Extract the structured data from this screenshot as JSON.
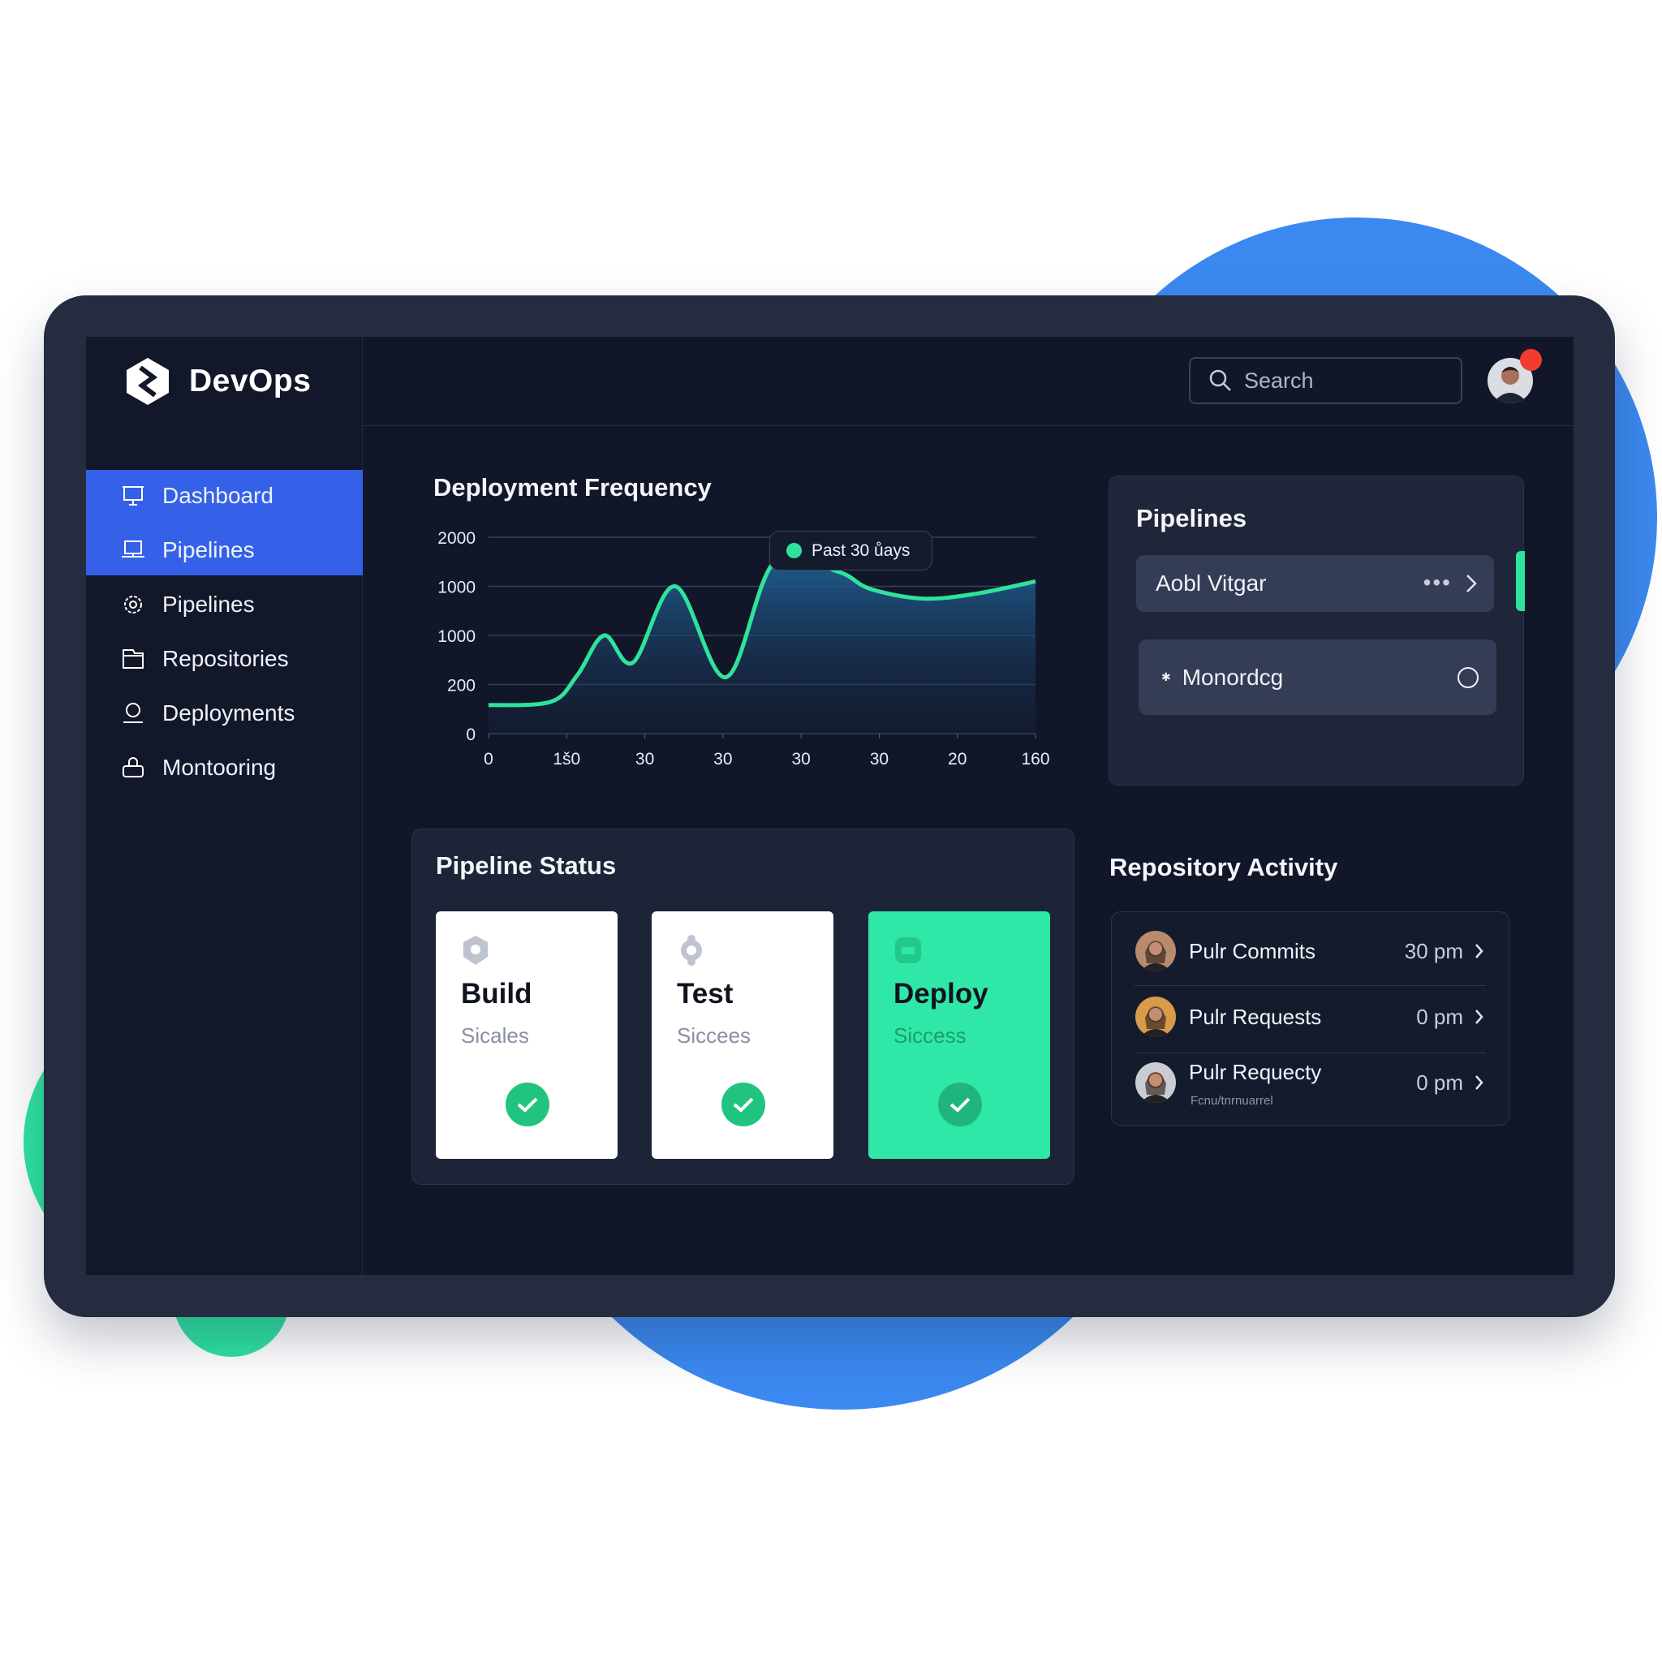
{
  "brand": {
    "name": "DevOps"
  },
  "sidebar": {
    "items": [
      {
        "label": "Dashboard",
        "icon": "presentation-icon",
        "active": true
      },
      {
        "label": "Pipelines",
        "icon": "monitor-icon",
        "active": true
      },
      {
        "label": "Pipelines",
        "icon": "gear-icon",
        "active": false
      },
      {
        "label": "Repositories",
        "icon": "folder-icon",
        "active": false
      },
      {
        "label": "Deployments",
        "icon": "user-icon",
        "active": false
      },
      {
        "label": "Montooring",
        "icon": "lock-icon",
        "active": false
      }
    ]
  },
  "header": {
    "search_placeholder": "Search",
    "notification": true
  },
  "deployment": {
    "title": "Deployment Frequency",
    "legend": "Past 30 ůays"
  },
  "chart_data": {
    "type": "area",
    "title": "Deployment Frequency",
    "legend": [
      "Past 30 ůays"
    ],
    "yticks": [
      "0",
      "200",
      "1000",
      "1000",
      "2000"
    ],
    "xticks": [
      "0",
      "1š0",
      "30",
      "30",
      "30",
      "30",
      "20",
      "160"
    ],
    "x": [
      0,
      0.8,
      1.14,
      1.48,
      1.85,
      2.39,
      3.04,
      3.66,
      4.47,
      4.88,
      5.56,
      6.24,
      7.0
    ],
    "y": [
      0.58,
      0.65,
      1.2,
      2.0,
      1.45,
      3.0,
      1.15,
      3.5,
      3.3,
      2.95,
      2.75,
      2.85,
      3.1
    ],
    "note": "y values in tick-index units (0..4), x in tick-index units (0..7)",
    "colors": {
      "line": "#2fe39b",
      "fill": "#1e5a8c"
    }
  },
  "pipelines": {
    "title": "Pipelines",
    "items": [
      {
        "label": "Aobl Vitgar"
      },
      {
        "label": "Monordcg"
      }
    ]
  },
  "status": {
    "title": "Pipeline Status",
    "cards": [
      {
        "title": "Build",
        "subtitle": "Sicales",
        "icon": "hexagon-icon"
      },
      {
        "title": "Test",
        "subtitle": "Siccees",
        "icon": "gear-icon"
      },
      {
        "title": "Deploy",
        "subtitle": "Siccess",
        "icon": "box-icon"
      }
    ]
  },
  "repo": {
    "title": "Repository Activity",
    "rows": [
      {
        "name": "Pulr Commits",
        "time": "30 pm",
        "sub": ""
      },
      {
        "name": "Pulr Requests",
        "time": "0 pm",
        "sub": ""
      },
      {
        "name": "Pulr Requecty",
        "time": "0 pm",
        "sub": "Fcnu/tnrnuarrel"
      }
    ]
  },
  "colors": {
    "accent": "#3561e8",
    "success": "#2fe8a8",
    "blob_blue": "#3b89f0",
    "blob_green": "#2fe3a0"
  }
}
